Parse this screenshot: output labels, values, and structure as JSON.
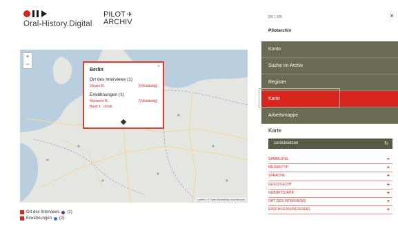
{
  "header": {
    "logo_text": "Oral-History.Digital",
    "pilot_line1": "PILOT",
    "pilot_line2": "ARCHIV"
  },
  "map": {
    "zoom_in": "+",
    "zoom_out": "−",
    "attribution": "Leaflet | © OpenStreetMap contributors",
    "popup": {
      "close": "×",
      "title": "Berlin",
      "section1": "Ort des Interviews (1)",
      "row1_left": "Jürgen R.",
      "row1_right": "[Vollständig]",
      "section2": "Erwähnungen (1)",
      "row2_left": "Marianne B.",
      "row2_right": "[Vollständig]",
      "row2_sub": "Band 1 · Inhalt"
    }
  },
  "legend": {
    "items": [
      {
        "label": "Ort des Interviews",
        "count": "(1)",
        "color": "#5b3a8c"
      },
      {
        "label": "Erwähnungen",
        "count": "(2)",
        "color": "#2a7fd0"
      }
    ]
  },
  "panel": {
    "lang": "DE | EN",
    "close": "×",
    "title": "Pilotarchiv",
    "menu": [
      "Konto",
      "Suche im Archiv",
      "Register",
      "Karte",
      "Arbeitsmappe"
    ],
    "section_heading": "Karte",
    "reset_label": "zurücksetzen",
    "reset_icon": "↻",
    "filters": [
      "SAMMLUNG",
      "MEDIENTYP",
      "SPRACHE",
      "GESCHLECHT",
      "GEBURTSJAHR",
      "ORT DES INTERVIEWS",
      "ERSCHLIESSUNGSGRAD"
    ],
    "filter_icon": "+"
  },
  "colors": {
    "accent": "#d7261e",
    "menu": "#6b6a52",
    "reset": "#5a5946"
  }
}
